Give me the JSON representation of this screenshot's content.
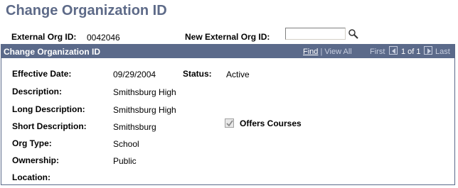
{
  "page": {
    "title": "Change Organization ID"
  },
  "header_fields": {
    "external_org_id_label": "External Org ID:",
    "external_org_id_value": "0042046",
    "new_external_org_id_label": "New External Org ID:",
    "new_external_org_id_value": "",
    "lookup_icon": "magnifier-icon"
  },
  "panel": {
    "title": "Change Organization ID",
    "nav": {
      "find": "Find",
      "separator": "|",
      "view_all": "View All",
      "first": "First",
      "position": "1 of 1",
      "last": "Last"
    },
    "fields": {
      "effective_date_label": "Effective Date:",
      "effective_date_value": "09/29/2004",
      "status_label": "Status:",
      "status_value": "Active",
      "description_label": "Description:",
      "description_value": "Smithsburg High",
      "long_description_label": "Long Description:",
      "long_description_value": "Smithsburg High",
      "short_description_label": "Short Description:",
      "short_description_value": "Smithsburg",
      "offers_courses_label": "Offers Courses",
      "offers_courses_checked": true,
      "org_type_label": "Org Type:",
      "org_type_value": "School",
      "ownership_label": "Ownership:",
      "ownership_value": "Public",
      "location_label": "Location:",
      "location_value": ""
    }
  },
  "colors": {
    "title": "#5d6a88",
    "panel_header": "#5b6a8a"
  }
}
